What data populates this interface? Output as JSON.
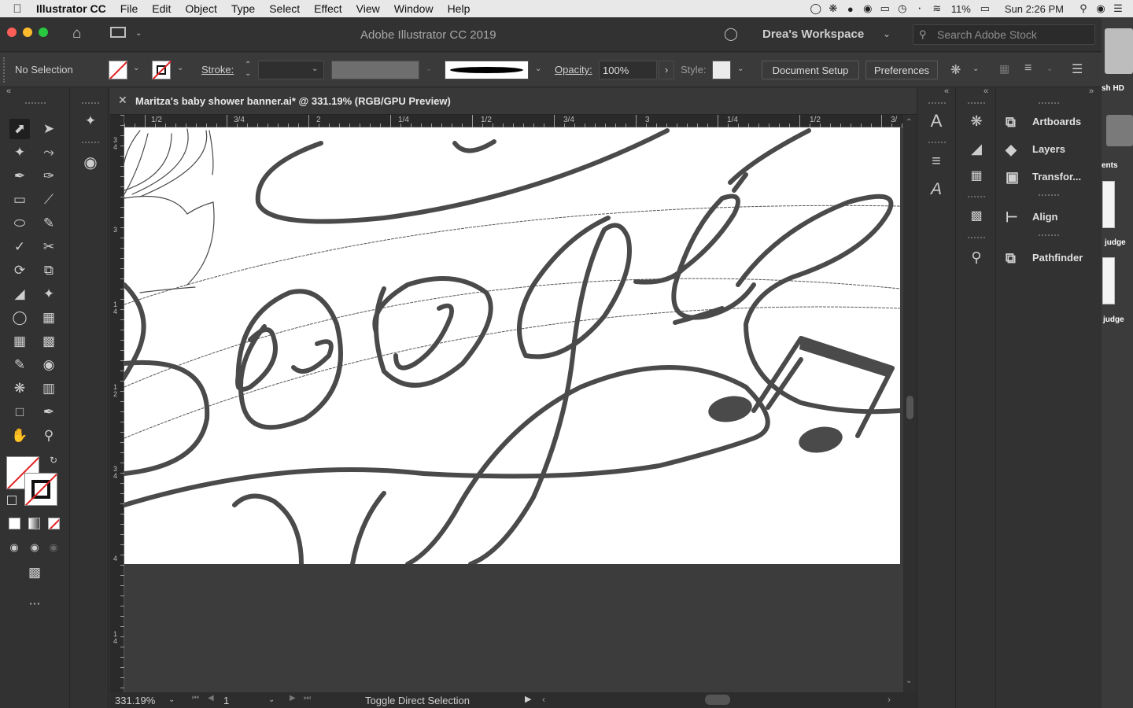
{
  "menubar": {
    "app_name": "Illustrator CC",
    "items": [
      "File",
      "Edit",
      "Object",
      "Type",
      "Select",
      "Effect",
      "View",
      "Window",
      "Help"
    ],
    "battery": "11%",
    "clock": "Sun 2:26 PM"
  },
  "appbar": {
    "title": "Adobe Illustrator CC 2019",
    "workspace": "Drea's Workspace",
    "search_placeholder": "Search Adobe Stock"
  },
  "control": {
    "selection": "No Selection",
    "stroke_label": "Stroke:",
    "opacity_label": "Opacity:",
    "opacity_value": "100%",
    "style_label": "Style:",
    "document_setup": "Document Setup",
    "preferences": "Preferences"
  },
  "document": {
    "tab_title": "Maritza's baby shower banner.ai* @ 331.19% (RGB/GPU Preview)",
    "h_ruler_labels": [
      "1/2",
      "3/4",
      "2",
      "1/4",
      "1/2",
      "3/4",
      "3",
      "1/4",
      "1/2",
      "3/"
    ],
    "v_ruler_labels": [
      "3 4",
      "3",
      "1 4",
      "1 2",
      "3 4",
      "4",
      "1 4"
    ]
  },
  "status": {
    "zoom": "331.19%",
    "artboard": "1",
    "message": "Toggle Direct Selection"
  },
  "panels": {
    "items": [
      "Artboards",
      "Layers",
      "Transfor...",
      "Align",
      "Pathfinder"
    ]
  },
  "desktop": {
    "labels": [
      "sh HD",
      "ents",
      "judge",
      "judge"
    ]
  },
  "colors": {
    "ui_dark": "#323232",
    "artwork_stroke": "#4a4a4a",
    "menubar": "#e8e8e8"
  }
}
